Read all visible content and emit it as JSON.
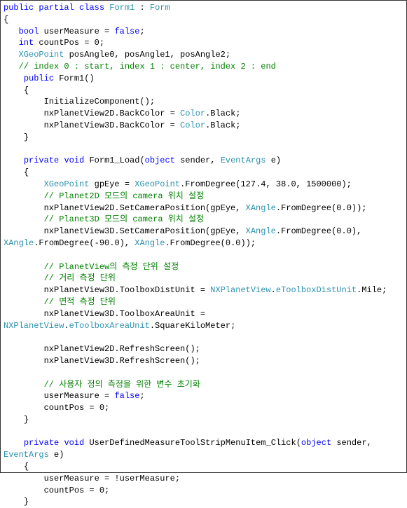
{
  "lines": [
    [
      {
        "c": "kw",
        "t": "public"
      },
      {
        "c": "plain",
        "t": " "
      },
      {
        "c": "kw",
        "t": "partial"
      },
      {
        "c": "plain",
        "t": " "
      },
      {
        "c": "kw",
        "t": "class"
      },
      {
        "c": "plain",
        "t": " "
      },
      {
        "c": "type",
        "t": "Form1"
      },
      {
        "c": "plain",
        "t": " : "
      },
      {
        "c": "type",
        "t": "Form"
      }
    ],
    [
      {
        "c": "plain",
        "t": "{"
      }
    ],
    [
      {
        "c": "plain",
        "t": "   "
      },
      {
        "c": "kw",
        "t": "bool"
      },
      {
        "c": "plain",
        "t": " userMeasure = "
      },
      {
        "c": "kw",
        "t": "false"
      },
      {
        "c": "plain",
        "t": ";"
      }
    ],
    [
      {
        "c": "plain",
        "t": "   "
      },
      {
        "c": "kw",
        "t": "int"
      },
      {
        "c": "plain",
        "t": " countPos = 0;"
      }
    ],
    [
      {
        "c": "plain",
        "t": "   "
      },
      {
        "c": "type",
        "t": "XGeoPoint"
      },
      {
        "c": "plain",
        "t": " posAngle0, posAngle1, posAngle2;"
      }
    ],
    [
      {
        "c": "plain",
        "t": "   "
      },
      {
        "c": "comment",
        "t": "// index 0 : start, index 1 : center, index 2 : end"
      }
    ],
    [
      {
        "c": "plain",
        "t": "    "
      },
      {
        "c": "kw",
        "t": "public"
      },
      {
        "c": "plain",
        "t": " Form1()"
      }
    ],
    [
      {
        "c": "plain",
        "t": "    {"
      }
    ],
    [
      {
        "c": "plain",
        "t": "        InitializeComponent();"
      }
    ],
    [
      {
        "c": "plain",
        "t": "        nxPlanetView2D.BackColor = "
      },
      {
        "c": "type",
        "t": "Color"
      },
      {
        "c": "plain",
        "t": ".Black;"
      }
    ],
    [
      {
        "c": "plain",
        "t": "        nxPlanetView3D.BackColor = "
      },
      {
        "c": "type",
        "t": "Color"
      },
      {
        "c": "plain",
        "t": ".Black;"
      }
    ],
    [
      {
        "c": "plain",
        "t": "    }"
      }
    ],
    [
      {
        "c": "plain",
        "t": ""
      }
    ],
    [
      {
        "c": "plain",
        "t": "    "
      },
      {
        "c": "kw",
        "t": "private"
      },
      {
        "c": "plain",
        "t": " "
      },
      {
        "c": "kw",
        "t": "void"
      },
      {
        "c": "plain",
        "t": " Form1_Load("
      },
      {
        "c": "kw",
        "t": "object"
      },
      {
        "c": "plain",
        "t": " sender, "
      },
      {
        "c": "type",
        "t": "EventArgs"
      },
      {
        "c": "plain",
        "t": " e)"
      }
    ],
    [
      {
        "c": "plain",
        "t": "    {"
      }
    ],
    [
      {
        "c": "plain",
        "t": "        "
      },
      {
        "c": "type",
        "t": "XGeoPoint"
      },
      {
        "c": "plain",
        "t": " gpEye = "
      },
      {
        "c": "type",
        "t": "XGeoPoint"
      },
      {
        "c": "plain",
        "t": ".FromDegree(127.4, 38.0, 1500000);"
      }
    ],
    [
      {
        "c": "plain",
        "t": "        "
      },
      {
        "c": "comment",
        "t": "// Planet2D 모드의 camera 위치 설정"
      }
    ],
    [
      {
        "c": "plain",
        "t": "        nxPlanetView2D.SetCameraPosition(gpEye, "
      },
      {
        "c": "type",
        "t": "XAngle"
      },
      {
        "c": "plain",
        "t": ".FromDegree(0.0));"
      }
    ],
    [
      {
        "c": "plain",
        "t": "        "
      },
      {
        "c": "comment",
        "t": "// Planet3D 모드의 camera 위치 설정"
      }
    ],
    [
      {
        "c": "plain",
        "t": "        nxPlanetView3D.SetCameraPosition(gpEye, "
      },
      {
        "c": "type",
        "t": "XAngle"
      },
      {
        "c": "plain",
        "t": ".FromDegree(0.0), "
      },
      {
        "c": "type",
        "t": "XAngle"
      },
      {
        "c": "plain",
        "t": ".FromDegree(-90.0), "
      },
      {
        "c": "type",
        "t": "XAngle"
      },
      {
        "c": "plain",
        "t": ".FromDegree(0.0));"
      }
    ],
    [
      {
        "c": "plain",
        "t": ""
      }
    ],
    [
      {
        "c": "plain",
        "t": "        "
      },
      {
        "c": "comment",
        "t": "// PlanetView의 측정 단위 설정"
      }
    ],
    [
      {
        "c": "plain",
        "t": "        "
      },
      {
        "c": "comment",
        "t": "// 거리 측정 단위"
      }
    ],
    [
      {
        "c": "plain",
        "t": "        nxPlanetView3D.ToolboxDistUnit = "
      },
      {
        "c": "type",
        "t": "NXPlanetView"
      },
      {
        "c": "plain",
        "t": "."
      },
      {
        "c": "type",
        "t": "eToolboxDistUnit"
      },
      {
        "c": "plain",
        "t": ".Mile;"
      }
    ],
    [
      {
        "c": "plain",
        "t": "        "
      },
      {
        "c": "comment",
        "t": "// 면적 측정 단위"
      }
    ],
    [
      {
        "c": "plain",
        "t": "        nxPlanetView3D.ToolboxAreaUnit = "
      },
      {
        "c": "type",
        "t": "NXPlanetView"
      },
      {
        "c": "plain",
        "t": "."
      },
      {
        "c": "type",
        "t": "eToolboxAreaUnit"
      },
      {
        "c": "plain",
        "t": ".SquareKiloMeter;"
      }
    ],
    [
      {
        "c": "plain",
        "t": ""
      }
    ],
    [
      {
        "c": "plain",
        "t": "        nxPlanetView2D.RefreshScreen();"
      }
    ],
    [
      {
        "c": "plain",
        "t": "        nxPlanetView3D.RefreshScreen();"
      }
    ],
    [
      {
        "c": "plain",
        "t": ""
      }
    ],
    [
      {
        "c": "plain",
        "t": "        "
      },
      {
        "c": "comment",
        "t": "// 사용자 정의 측정을 위한 변수 초기화"
      }
    ],
    [
      {
        "c": "plain",
        "t": "        userMeasure = "
      },
      {
        "c": "kw",
        "t": "false"
      },
      {
        "c": "plain",
        "t": ";"
      }
    ],
    [
      {
        "c": "plain",
        "t": "        countPos = 0;"
      }
    ],
    [
      {
        "c": "plain",
        "t": "    }"
      }
    ],
    [
      {
        "c": "plain",
        "t": ""
      }
    ],
    [
      {
        "c": "plain",
        "t": "    "
      },
      {
        "c": "kw",
        "t": "private"
      },
      {
        "c": "plain",
        "t": " "
      },
      {
        "c": "kw",
        "t": "void"
      },
      {
        "c": "plain",
        "t": " UserDefinedMeasureToolStripMenuItem_Click("
      },
      {
        "c": "kw",
        "t": "object"
      },
      {
        "c": "plain",
        "t": " sender, "
      },
      {
        "c": "type",
        "t": "EventArgs"
      },
      {
        "c": "plain",
        "t": " e)"
      }
    ],
    [
      {
        "c": "plain",
        "t": "    {"
      }
    ],
    [
      {
        "c": "plain",
        "t": "        userMeasure = !userMeasure;"
      }
    ],
    [
      {
        "c": "plain",
        "t": "        countPos = 0;"
      }
    ],
    [
      {
        "c": "plain",
        "t": "    }"
      }
    ]
  ]
}
